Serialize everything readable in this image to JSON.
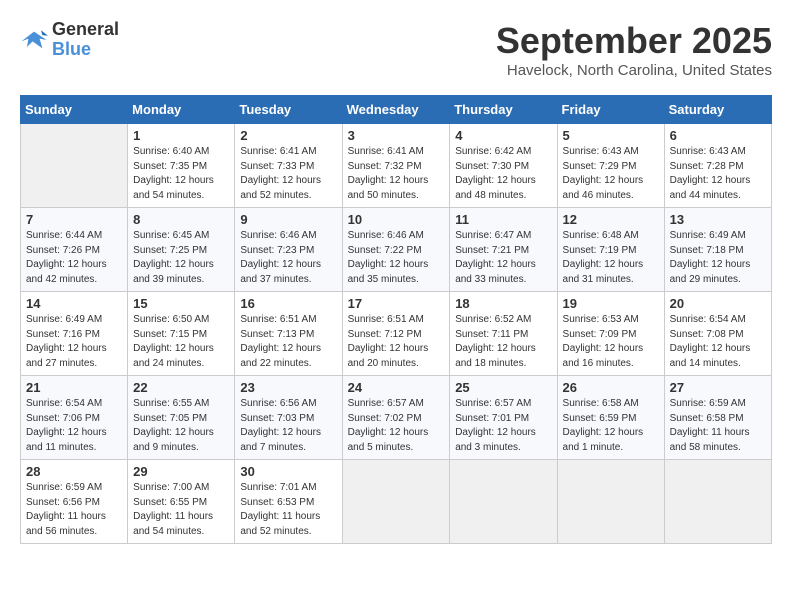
{
  "header": {
    "logo_line1": "General",
    "logo_line2": "Blue",
    "month": "September 2025",
    "location": "Havelock, North Carolina, United States"
  },
  "days_of_week": [
    "Sunday",
    "Monday",
    "Tuesday",
    "Wednesday",
    "Thursday",
    "Friday",
    "Saturday"
  ],
  "weeks": [
    [
      {
        "day": "",
        "info": ""
      },
      {
        "day": "1",
        "info": "Sunrise: 6:40 AM\nSunset: 7:35 PM\nDaylight: 12 hours\nand 54 minutes."
      },
      {
        "day": "2",
        "info": "Sunrise: 6:41 AM\nSunset: 7:33 PM\nDaylight: 12 hours\nand 52 minutes."
      },
      {
        "day": "3",
        "info": "Sunrise: 6:41 AM\nSunset: 7:32 PM\nDaylight: 12 hours\nand 50 minutes."
      },
      {
        "day": "4",
        "info": "Sunrise: 6:42 AM\nSunset: 7:30 PM\nDaylight: 12 hours\nand 48 minutes."
      },
      {
        "day": "5",
        "info": "Sunrise: 6:43 AM\nSunset: 7:29 PM\nDaylight: 12 hours\nand 46 minutes."
      },
      {
        "day": "6",
        "info": "Sunrise: 6:43 AM\nSunset: 7:28 PM\nDaylight: 12 hours\nand 44 minutes."
      }
    ],
    [
      {
        "day": "7",
        "info": "Sunrise: 6:44 AM\nSunset: 7:26 PM\nDaylight: 12 hours\nand 42 minutes."
      },
      {
        "day": "8",
        "info": "Sunrise: 6:45 AM\nSunset: 7:25 PM\nDaylight: 12 hours\nand 39 minutes."
      },
      {
        "day": "9",
        "info": "Sunrise: 6:46 AM\nSunset: 7:23 PM\nDaylight: 12 hours\nand 37 minutes."
      },
      {
        "day": "10",
        "info": "Sunrise: 6:46 AM\nSunset: 7:22 PM\nDaylight: 12 hours\nand 35 minutes."
      },
      {
        "day": "11",
        "info": "Sunrise: 6:47 AM\nSunset: 7:21 PM\nDaylight: 12 hours\nand 33 minutes."
      },
      {
        "day": "12",
        "info": "Sunrise: 6:48 AM\nSunset: 7:19 PM\nDaylight: 12 hours\nand 31 minutes."
      },
      {
        "day": "13",
        "info": "Sunrise: 6:49 AM\nSunset: 7:18 PM\nDaylight: 12 hours\nand 29 minutes."
      }
    ],
    [
      {
        "day": "14",
        "info": "Sunrise: 6:49 AM\nSunset: 7:16 PM\nDaylight: 12 hours\nand 27 minutes."
      },
      {
        "day": "15",
        "info": "Sunrise: 6:50 AM\nSunset: 7:15 PM\nDaylight: 12 hours\nand 24 minutes."
      },
      {
        "day": "16",
        "info": "Sunrise: 6:51 AM\nSunset: 7:13 PM\nDaylight: 12 hours\nand 22 minutes."
      },
      {
        "day": "17",
        "info": "Sunrise: 6:51 AM\nSunset: 7:12 PM\nDaylight: 12 hours\nand 20 minutes."
      },
      {
        "day": "18",
        "info": "Sunrise: 6:52 AM\nSunset: 7:11 PM\nDaylight: 12 hours\nand 18 minutes."
      },
      {
        "day": "19",
        "info": "Sunrise: 6:53 AM\nSunset: 7:09 PM\nDaylight: 12 hours\nand 16 minutes."
      },
      {
        "day": "20",
        "info": "Sunrise: 6:54 AM\nSunset: 7:08 PM\nDaylight: 12 hours\nand 14 minutes."
      }
    ],
    [
      {
        "day": "21",
        "info": "Sunrise: 6:54 AM\nSunset: 7:06 PM\nDaylight: 12 hours\nand 11 minutes."
      },
      {
        "day": "22",
        "info": "Sunrise: 6:55 AM\nSunset: 7:05 PM\nDaylight: 12 hours\nand 9 minutes."
      },
      {
        "day": "23",
        "info": "Sunrise: 6:56 AM\nSunset: 7:03 PM\nDaylight: 12 hours\nand 7 minutes."
      },
      {
        "day": "24",
        "info": "Sunrise: 6:57 AM\nSunset: 7:02 PM\nDaylight: 12 hours\nand 5 minutes."
      },
      {
        "day": "25",
        "info": "Sunrise: 6:57 AM\nSunset: 7:01 PM\nDaylight: 12 hours\nand 3 minutes."
      },
      {
        "day": "26",
        "info": "Sunrise: 6:58 AM\nSunset: 6:59 PM\nDaylight: 12 hours\nand 1 minute."
      },
      {
        "day": "27",
        "info": "Sunrise: 6:59 AM\nSunset: 6:58 PM\nDaylight: 11 hours\nand 58 minutes."
      }
    ],
    [
      {
        "day": "28",
        "info": "Sunrise: 6:59 AM\nSunset: 6:56 PM\nDaylight: 11 hours\nand 56 minutes."
      },
      {
        "day": "29",
        "info": "Sunrise: 7:00 AM\nSunset: 6:55 PM\nDaylight: 11 hours\nand 54 minutes."
      },
      {
        "day": "30",
        "info": "Sunrise: 7:01 AM\nSunset: 6:53 PM\nDaylight: 11 hours\nand 52 minutes."
      },
      {
        "day": "",
        "info": ""
      },
      {
        "day": "",
        "info": ""
      },
      {
        "day": "",
        "info": ""
      },
      {
        "day": "",
        "info": ""
      }
    ]
  ]
}
